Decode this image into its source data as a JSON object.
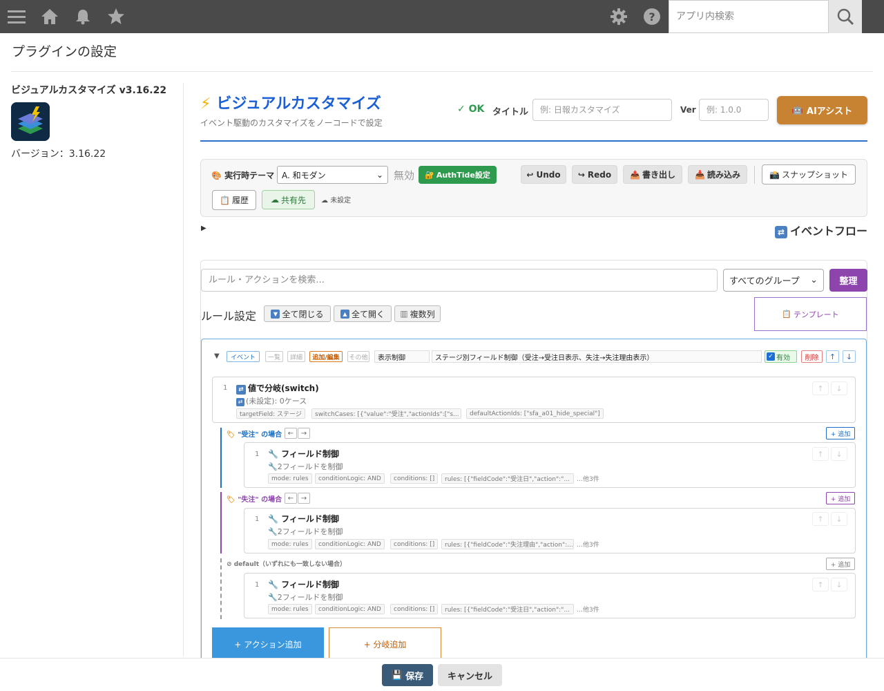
{
  "topbar": {
    "search_placeholder": "アプリ内検索"
  },
  "page_title": "プラグインの設定",
  "plugin": {
    "name": "ビジュアルカスタマイズ v3.16.22",
    "version_label": "バージョン：3.16.22"
  },
  "header": {
    "title": "ビジュアルカスタマイズ",
    "subtitle": "イベント駆動のカスタマイズをノーコードで設定",
    "status": "✓ OK",
    "title_label": "タイトル",
    "title_placeholder": "例: 日報カスタマイズ",
    "ver_label": "Ver",
    "ver_placeholder": "例: 1.0.0",
    "ai_button": "AIアシスト"
  },
  "toolbar": {
    "theme_label": "実行時テーマ",
    "theme_value": "A. 和モダン",
    "disabled_text": "無効",
    "authtide": "AuthTide設定",
    "undo": "Undo",
    "redo": "Redo",
    "export": "書き出し",
    "import": "読み込み",
    "snapshot": "スナップショット",
    "history": "履歴",
    "share": "共有先",
    "unset": "未設定"
  },
  "event_flow_label": "イベントフロー",
  "rules": {
    "search_placeholder": "ルール・アクションを検索...",
    "group_select": "すべてのグループ",
    "organize": "整理",
    "title": "ルール設定",
    "collapse_all": "全て閉じる",
    "expand_all": "全て開く",
    "multi_col": "複数列",
    "template": "テンプレート"
  },
  "rule": {
    "tags": [
      "イベント",
      "一覧",
      "詳細",
      "追加/編集",
      "その他"
    ],
    "name": "表示制御",
    "description": "ステージ別フィールド制御（受注→受注日表示、失注→失注理由表示）",
    "enabled": "有効",
    "delete": "削除",
    "switch": {
      "num": "1",
      "title": "値で分岐(switch)",
      "sub": "(未設定): 0ケース",
      "chips": [
        "targetField: ステージ",
        "switchCases: [{\"value\":\"受注\",\"actionIds\":[\"s...",
        "defaultActionIds: [\"sfa_a01_hide_special\"]"
      ]
    },
    "cases": [
      {
        "label": "\"受注\" の場合",
        "add": "+ 追加",
        "num": "1",
        "title": "フィールド制御",
        "sub": "2フィールドを制御",
        "chips": [
          "mode: rules",
          "conditionLogic: AND",
          "conditions: []",
          "rules: [{\"fieldCode\":\"受注日\",\"action\":\"..."
        ],
        "more": "…他3件"
      },
      {
        "label": "\"失注\" の場合",
        "add": "+ 追加",
        "num": "1",
        "title": "フィールド制御",
        "sub": "2フィールドを制御",
        "chips": [
          "mode: rules",
          "conditionLogic: AND",
          "conditions: []",
          "rules: [{\"fieldCode\":\"失注理由\",\"action\":..."
        ],
        "more": "…他3件"
      },
      {
        "label": "default（いずれにも一致しない場合）",
        "add": "+ 追加",
        "num": "1",
        "title": "フィールド制御",
        "sub": "2フィールドを制御",
        "chips": [
          "mode: rules",
          "conditionLogic: AND",
          "conditions: []",
          "rules: [{\"fieldCode\":\"受注日\",\"action\":\"..."
        ],
        "more": "…他3件"
      }
    ],
    "add_action": "+ アクション追加",
    "add_branch": "+ 分岐追加"
  },
  "footer": {
    "save": "保存",
    "cancel": "キャンセル"
  },
  "colors": {
    "accent_blue": "#1b5fd6",
    "ok_green": "#2e9a4d",
    "ai_orange": "#c78232",
    "purple": "#8e44ad",
    "topbar": "#4a4a4a"
  }
}
